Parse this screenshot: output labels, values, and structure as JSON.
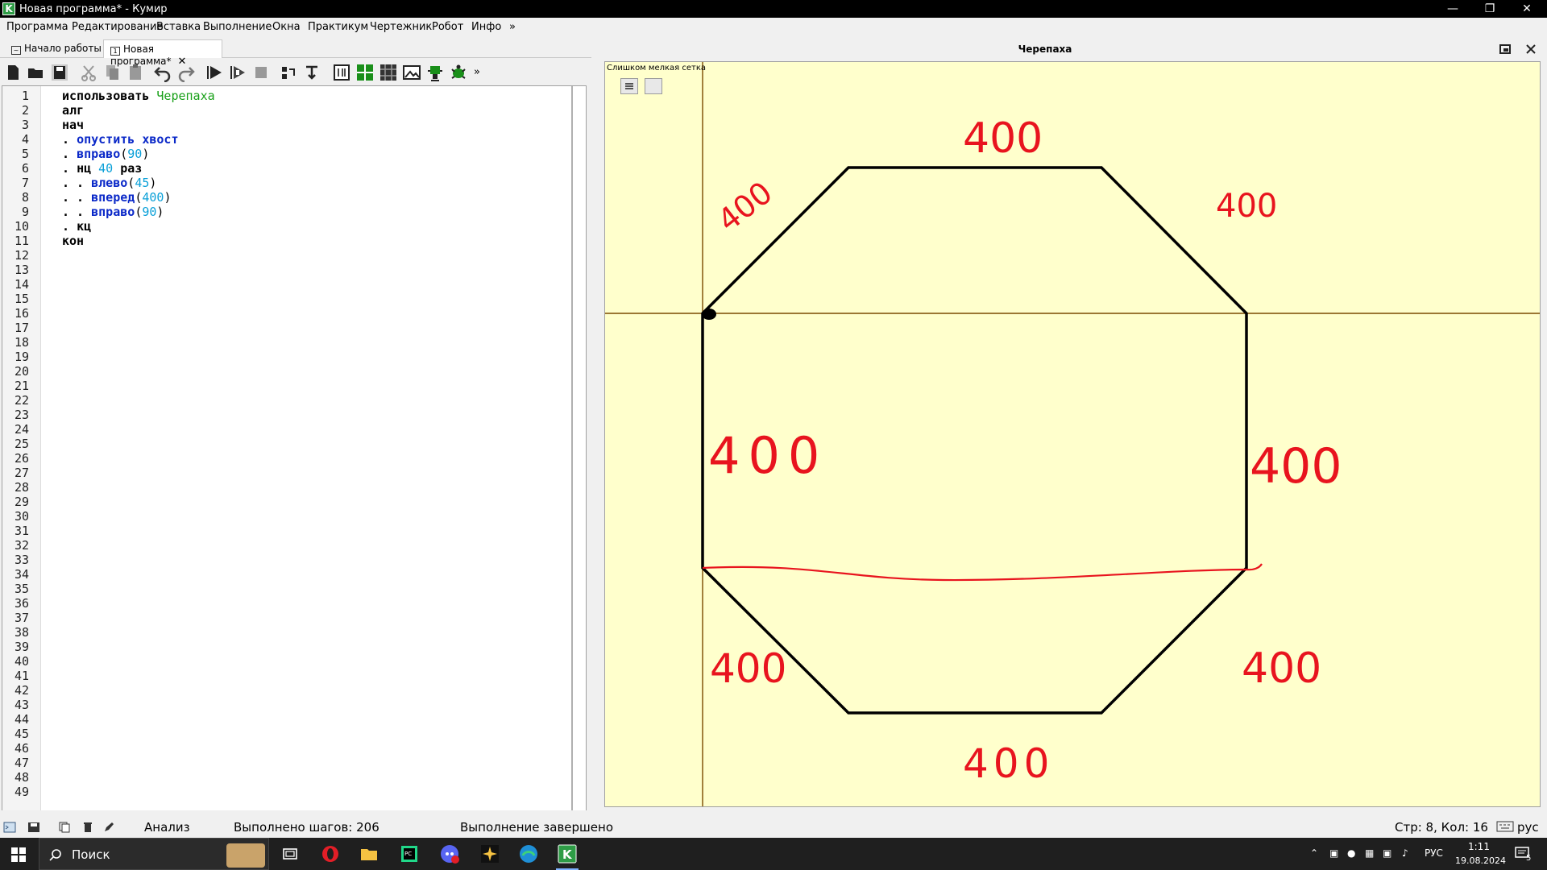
{
  "window": {
    "title": "Новая программа* - Кумир",
    "logo": "K"
  },
  "menu": [
    "Программа",
    "Редактирование",
    "Вставка",
    "Выполнение",
    "Окна",
    "Практикум",
    "Чертежник",
    "Робот",
    "Инфо",
    "»"
  ],
  "tabs": [
    {
      "label": "Начало работы",
      "active": false
    },
    {
      "label": "Новая программа*",
      "active": true
    }
  ],
  "toolbar": {
    "icons": [
      "new-file-icon",
      "open-folder-icon",
      "save-icon",
      "cut-icon",
      "copy-icon",
      "paste-icon",
      "undo-icon",
      "redo-icon",
      "run-icon",
      "step-run-icon",
      "stop-icon",
      "step-into-icon",
      "step-out-icon",
      "variables-icon",
      "grid-green-icon",
      "grid-dark-icon",
      "image-icon",
      "robot-icon",
      "turtle-icon"
    ],
    "overflow": "»"
  },
  "editor": {
    "line_count": 49,
    "code_lines": [
      {
        "kw": "использовать",
        "mod": "Черепаха"
      },
      {
        "kw": "алг"
      },
      {
        "kw": "нач"
      },
      {
        "dots": ". ",
        "call": "опустить хвост"
      },
      {
        "dots": ". ",
        "call": "вправо",
        "arg": "90"
      },
      {
        "dots": ". ",
        "kw": "нц",
        "num": "40",
        "kw2": "раз"
      },
      {
        "dots": ". . ",
        "call": "влево",
        "arg": "45"
      },
      {
        "dots": ". . ",
        "call": "вперед",
        "arg": "400"
      },
      {
        "dots": ". . ",
        "call": "вправо",
        "arg": "90"
      },
      {
        "dots": ". ",
        "kw": "кц"
      },
      {
        "kw": "кон"
      }
    ]
  },
  "turtle": {
    "title": "Черепаха",
    "grid_label": "Слишком мелкая сетка",
    "annotations": [
      "400",
      "400",
      "400",
      "400",
      "400",
      "400",
      "400",
      "400"
    ],
    "colors": {
      "canvas": "#ffffcc",
      "axis": "#7a4a00",
      "path": "#000000",
      "ink": "#e8141e"
    }
  },
  "status": {
    "mode": "Анализ",
    "steps": "Выполнено шагов: 206",
    "message": "Выполнение завершено",
    "position": "Стр: 8, Кол: 16",
    "lang": "рус"
  },
  "taskbar": {
    "search": "Поиск",
    "tray_lang": "РУС",
    "time": "1:11",
    "date": "19.08.2024",
    "notifications": "5"
  }
}
